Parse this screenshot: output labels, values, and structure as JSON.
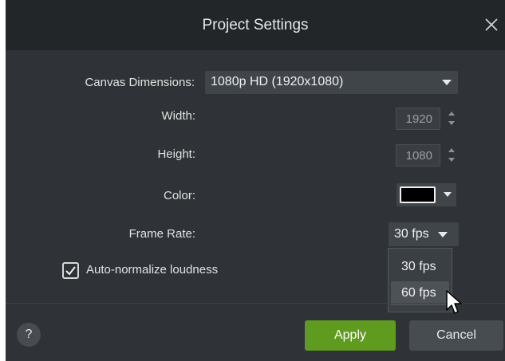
{
  "dialog": {
    "title": "Project Settings",
    "close_icon": "close-icon"
  },
  "canvas_dimensions": {
    "label": "Canvas Dimensions:",
    "value": "1080p HD (1920x1080)"
  },
  "width": {
    "label": "Width:",
    "value": "1920"
  },
  "height": {
    "label": "Height:",
    "value": "1080"
  },
  "color": {
    "label": "Color:",
    "swatch_color": "#000000"
  },
  "frame_rate": {
    "label": "Frame Rate:",
    "value": "30 fps",
    "options": [
      "30 fps",
      "60 fps"
    ],
    "hovered_option": "60 fps"
  },
  "auto_normalize": {
    "label": "Auto-normalize loudness",
    "checked": true
  },
  "footer": {
    "help_label": "?",
    "apply_label": "Apply",
    "cancel_label": "Cancel"
  },
  "colors": {
    "dialog_bg": "#2f3337",
    "titlebar_bg": "#232629",
    "apply_green": "#5e9b1f",
    "control_bg": "#40454a"
  }
}
